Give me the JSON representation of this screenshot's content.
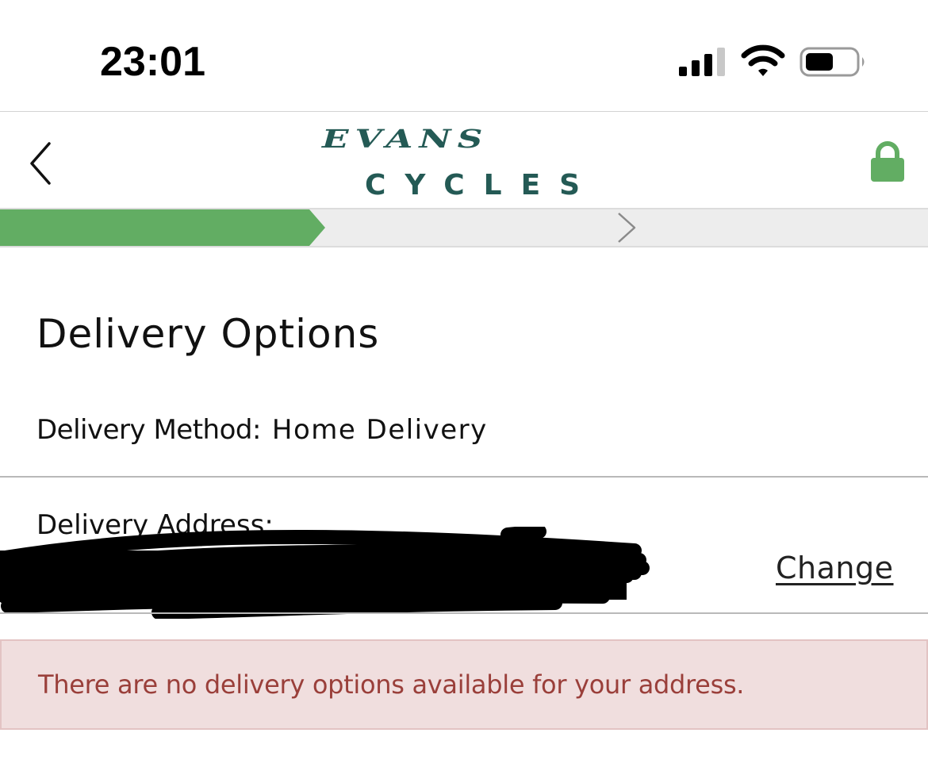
{
  "status_bar": {
    "time": "23:01",
    "icons": [
      "cellular-signal-icon",
      "wifi-icon",
      "battery-icon"
    ],
    "battery_level": 0.5
  },
  "header": {
    "back_icon": "chevron-left-icon",
    "logo_line1": "EVANS",
    "logo_line2": "CYCLES",
    "logo_color": "#245a55",
    "secure_icon": "lock-icon",
    "secure_color": "#62ad63"
  },
  "progress": {
    "completed_fraction": 0.35,
    "fill_color": "#62ad63",
    "track_color": "#ededed"
  },
  "page": {
    "title": "Delivery Options",
    "delivery_method_label": "Delivery Method:",
    "delivery_method_value": "Home Delivery",
    "delivery_address_label": "Delivery Address:",
    "change_link": "Change"
  },
  "alert": {
    "message": "There are no delivery options available for your address.",
    "text_color": "#9a3f3a",
    "background_color": "#f0dede"
  }
}
